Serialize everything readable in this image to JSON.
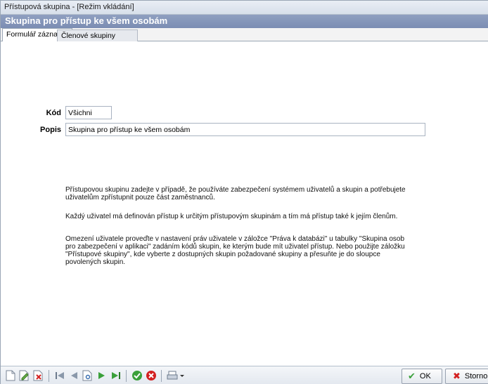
{
  "window": {
    "title": "Přístupová skupina - [Režim vkládání]",
    "caption": "Skupina pro přístup ke všem osobám"
  },
  "tabs": [
    {
      "label": "Formulář záznamu",
      "active": true
    },
    {
      "label": "Členové skupiny",
      "active": false
    }
  ],
  "form": {
    "kod_label": "Kód",
    "kod_value": "Všichni",
    "popis_label": "Popis",
    "popis_value": "Skupina pro přístup ke všem osobám"
  },
  "help": {
    "p1_line1": "Přístupovou skupinu zadejte v případě, že používáte zabezpečení systémem uživatelů a skupin a potřebujete",
    "p1_line2": "uživatelům zpřístupnit pouze část zaměstnanců.",
    "p2_line1": "Každý uživatel má definován přístup k určitým přístupovým skupinám a tím má přístup také k jejím členům.",
    "p3_line1": "Omezení uživatele proveďte v nastavení práv uživatele v záložce \"Práva k databázi\" u tabulky \"Skupina osob",
    "p3_line2": "pro zabezpečení v aplikaci\" zadáním kódů skupin, ke kterým bude mít uživatel přístup. Nebo použijte záložku",
    "p3_line3": "\"Přístupové skupiny\", kde vyberte z dostupných skupin požadované skupiny a přesuňte je do sloupce",
    "p3_line4": "povolených skupin."
  },
  "toolbar": {
    "icons": [
      "new-record-icon",
      "edit-record-icon",
      "delete-record-icon",
      "first-record-icon",
      "previous-record-icon",
      "find-record-icon",
      "next-record-icon",
      "last-record-icon",
      "confirm-icon",
      "cancel-icon",
      "print-icon"
    ],
    "ok_label": "OK",
    "cancel_label": "Storno"
  },
  "colors": {
    "caption_bg": "#7f90b5",
    "ok_check": "#3aa03a",
    "cancel_x": "#d32020"
  }
}
